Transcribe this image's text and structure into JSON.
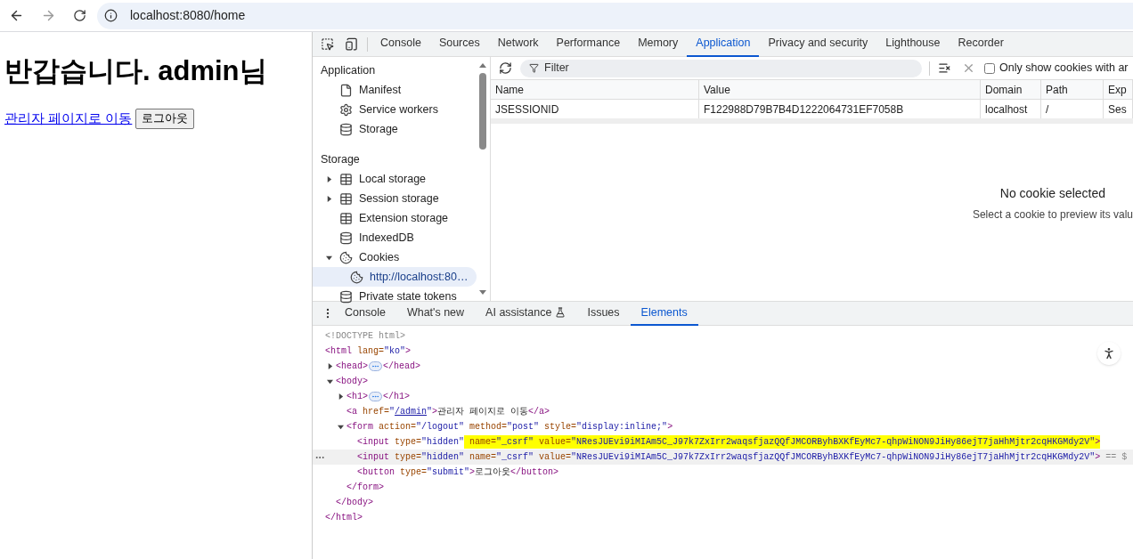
{
  "browser": {
    "url": "localhost:8080/home"
  },
  "page": {
    "heading": "반갑습니다. admin님",
    "link": "관리자 페이지로 이동",
    "button": "로그아웃"
  },
  "devtools": {
    "tabs": [
      {
        "label": "Console",
        "selected": false
      },
      {
        "label": "Sources",
        "selected": false
      },
      {
        "label": "Network",
        "selected": false
      },
      {
        "label": "Performance",
        "selected": false
      },
      {
        "label": "Memory",
        "selected": false
      },
      {
        "label": "Application",
        "selected": true
      },
      {
        "label": "Privacy and security",
        "selected": false
      },
      {
        "label": "Lighthouse",
        "selected": false
      },
      {
        "label": "Recorder",
        "selected": false
      }
    ],
    "sidebar": [
      {
        "title": "Application",
        "items": [
          {
            "label": "Manifest",
            "kind": "file",
            "selected": false
          },
          {
            "label": "Service workers",
            "kind": "gears",
            "selected": false
          },
          {
            "label": "Storage",
            "kind": "database",
            "selected": false
          }
        ]
      },
      {
        "title": "Storage",
        "items": [
          {
            "label": "Local storage",
            "kind": "table",
            "expanded": false,
            "selected": false
          },
          {
            "label": "Session storage",
            "kind": "table",
            "expanded": false,
            "selected": false
          },
          {
            "label": "Extension storage",
            "kind": "table",
            "selected": false
          },
          {
            "label": "IndexedDB",
            "kind": "database",
            "selected": false
          },
          {
            "label": "Cookies",
            "kind": "cookie",
            "expanded": true,
            "selected": false,
            "children": [
              {
                "label": "http://localhost:80…",
                "kind": "cookie",
                "selected": true
              }
            ]
          },
          {
            "label": "Private state tokens",
            "kind": "database",
            "selected": false
          }
        ]
      }
    ],
    "cookies": {
      "filter_placeholder": "Filter",
      "only_show_label": "Only show cookies with ar",
      "only_show_checked": false,
      "columns": [
        "Name",
        "Value",
        "Domain",
        "Path",
        "Exp"
      ],
      "rows": [
        [
          "JSESSIONID",
          "F122988D79B7B4D1222064731EF7058B",
          "localhost",
          "/",
          "Ses"
        ]
      ],
      "empty_title": "No cookie selected",
      "empty_text": "Select a cookie to preview its valu"
    },
    "drawer_tabs": [
      {
        "label": "Console",
        "selected": false
      },
      {
        "label": "What's new",
        "selected": false
      },
      {
        "label": "AI assistance",
        "kind": "flask",
        "selected": false
      },
      {
        "label": "Issues",
        "selected": false
      },
      {
        "label": "Elements",
        "selected": true
      }
    ],
    "dom": [
      {
        "open": [
          {
            "kind": "doc",
            "text": "<!DOCTYPE html>"
          }
        ]
      },
      {
        "open": [
          {
            "kind": "tag",
            "text": "<html"
          },
          {
            "kind": "attr",
            "text": " lang="
          },
          {
            "kind": "val",
            "text": "\"ko\""
          },
          {
            "kind": "tag",
            "text": ">"
          }
        ],
        "children": [
          {
            "open": [
              {
                "kind": "tag",
                "text": "<head>"
              },
              {
                "kind": "more"
              },
              {
                "kind": "tag",
                "text": "</head>"
              }
            ],
            "expanded": false
          },
          {
            "open": [
              {
                "kind": "tag",
                "text": "<body>"
              }
            ],
            "expanded": true,
            "close": [
              {
                "kind": "tag",
                "text": "</body>"
              }
            ],
            "children": [
              {
                "open": [
                  {
                    "kind": "tag",
                    "text": "<h1>"
                  },
                  {
                    "kind": "more"
                  },
                  {
                    "kind": "tag",
                    "text": "</h1>"
                  }
                ],
                "expanded": false
              },
              {
                "open": [
                  {
                    "kind": "tag",
                    "text": "<a"
                  },
                  {
                    "kind": "attr",
                    "text": " href="
                  },
                  {
                    "kind": "val",
                    "text": "\""
                  },
                  {
                    "kind": "link",
                    "text": "/admin"
                  },
                  {
                    "kind": "val",
                    "text": "\""
                  },
                  {
                    "kind": "tag",
                    "text": ">"
                  },
                  {
                    "kind": "text",
                    "text": "관리자 페이지로 이동"
                  },
                  {
                    "kind": "tag",
                    "text": "</a>"
                  }
                ]
              },
              {
                "open": [
                  {
                    "kind": "tag",
                    "text": "<form"
                  },
                  {
                    "kind": "attr",
                    "text": " action="
                  },
                  {
                    "kind": "val",
                    "text": "\"/logout\""
                  },
                  {
                    "kind": "attr",
                    "text": " method="
                  },
                  {
                    "kind": "val",
                    "text": "\"post\""
                  },
                  {
                    "kind": "attr",
                    "text": " style="
                  },
                  {
                    "kind": "val",
                    "text": "\"display:inline;\""
                  },
                  {
                    "kind": "tag",
                    "text": ">"
                  }
                ],
                "expanded": true,
                "close": [
                  {
                    "kind": "tag",
                    "text": "</form>"
                  }
                ],
                "children": [
                  {
                    "open": [
                      {
                        "kind": "tag",
                        "text": "<input"
                      },
                      {
                        "kind": "attr",
                        "text": " type="
                      },
                      {
                        "kind": "val",
                        "text": "\"hidden\""
                      },
                      {
                        "kind": "attr",
                        "text": " name=",
                        "highlight": true
                      },
                      {
                        "kind": "val",
                        "text": "\"_csrf\"",
                        "highlight": true
                      },
                      {
                        "kind": "attr",
                        "text": " value=",
                        "highlight": true
                      },
                      {
                        "kind": "val",
                        "text": "\"NResJUEvi9iMIAm5C_J97k7ZxIrr2waqsfjazQQfJMCORByhBXKfEyMc7-qhpWiNON9JiHy86ejT7jaHhMjtr2cqHKGMdy2V\"",
                        "highlight": true
                      },
                      {
                        "kind": "tag",
                        "text": ">",
                        "highlight": true
                      }
                    ]
                  },
                  {
                    "hovered": true,
                    "open": [
                      {
                        "kind": "tag",
                        "text": "<input"
                      },
                      {
                        "kind": "attr",
                        "text": " type="
                      },
                      {
                        "kind": "val",
                        "text": "\"hidden\""
                      },
                      {
                        "kind": "attr",
                        "text": " name="
                      },
                      {
                        "kind": "val",
                        "text": "\"_csrf\""
                      },
                      {
                        "kind": "attr",
                        "text": " value="
                      },
                      {
                        "kind": "val",
                        "text": "\"NResJUEvi9iMIAm5C_J97k7ZxIrr2waqsfjazQQfJMCORByhBXKfEyMc7-qhpWiNON9JiHy86ejT7jaHhMjtr2cqHKGMdy2V\""
                      },
                      {
                        "kind": "tag",
                        "text": ">"
                      },
                      {
                        "kind": "ref",
                        "text": " == $"
                      }
                    ]
                  },
                  {
                    "open": [
                      {
                        "kind": "tag",
                        "text": "<button"
                      },
                      {
                        "kind": "attr",
                        "text": " type="
                      },
                      {
                        "kind": "val",
                        "text": "\"submit\""
                      },
                      {
                        "kind": "tag",
                        "text": ">"
                      },
                      {
                        "kind": "text",
                        "text": "로그아웃"
                      },
                      {
                        "kind": "tag",
                        "text": "</button>"
                      }
                    ]
                  }
                ]
              }
            ]
          }
        ],
        "close": [
          {
            "kind": "tag",
            "text": "</html>"
          }
        ]
      }
    ]
  }
}
